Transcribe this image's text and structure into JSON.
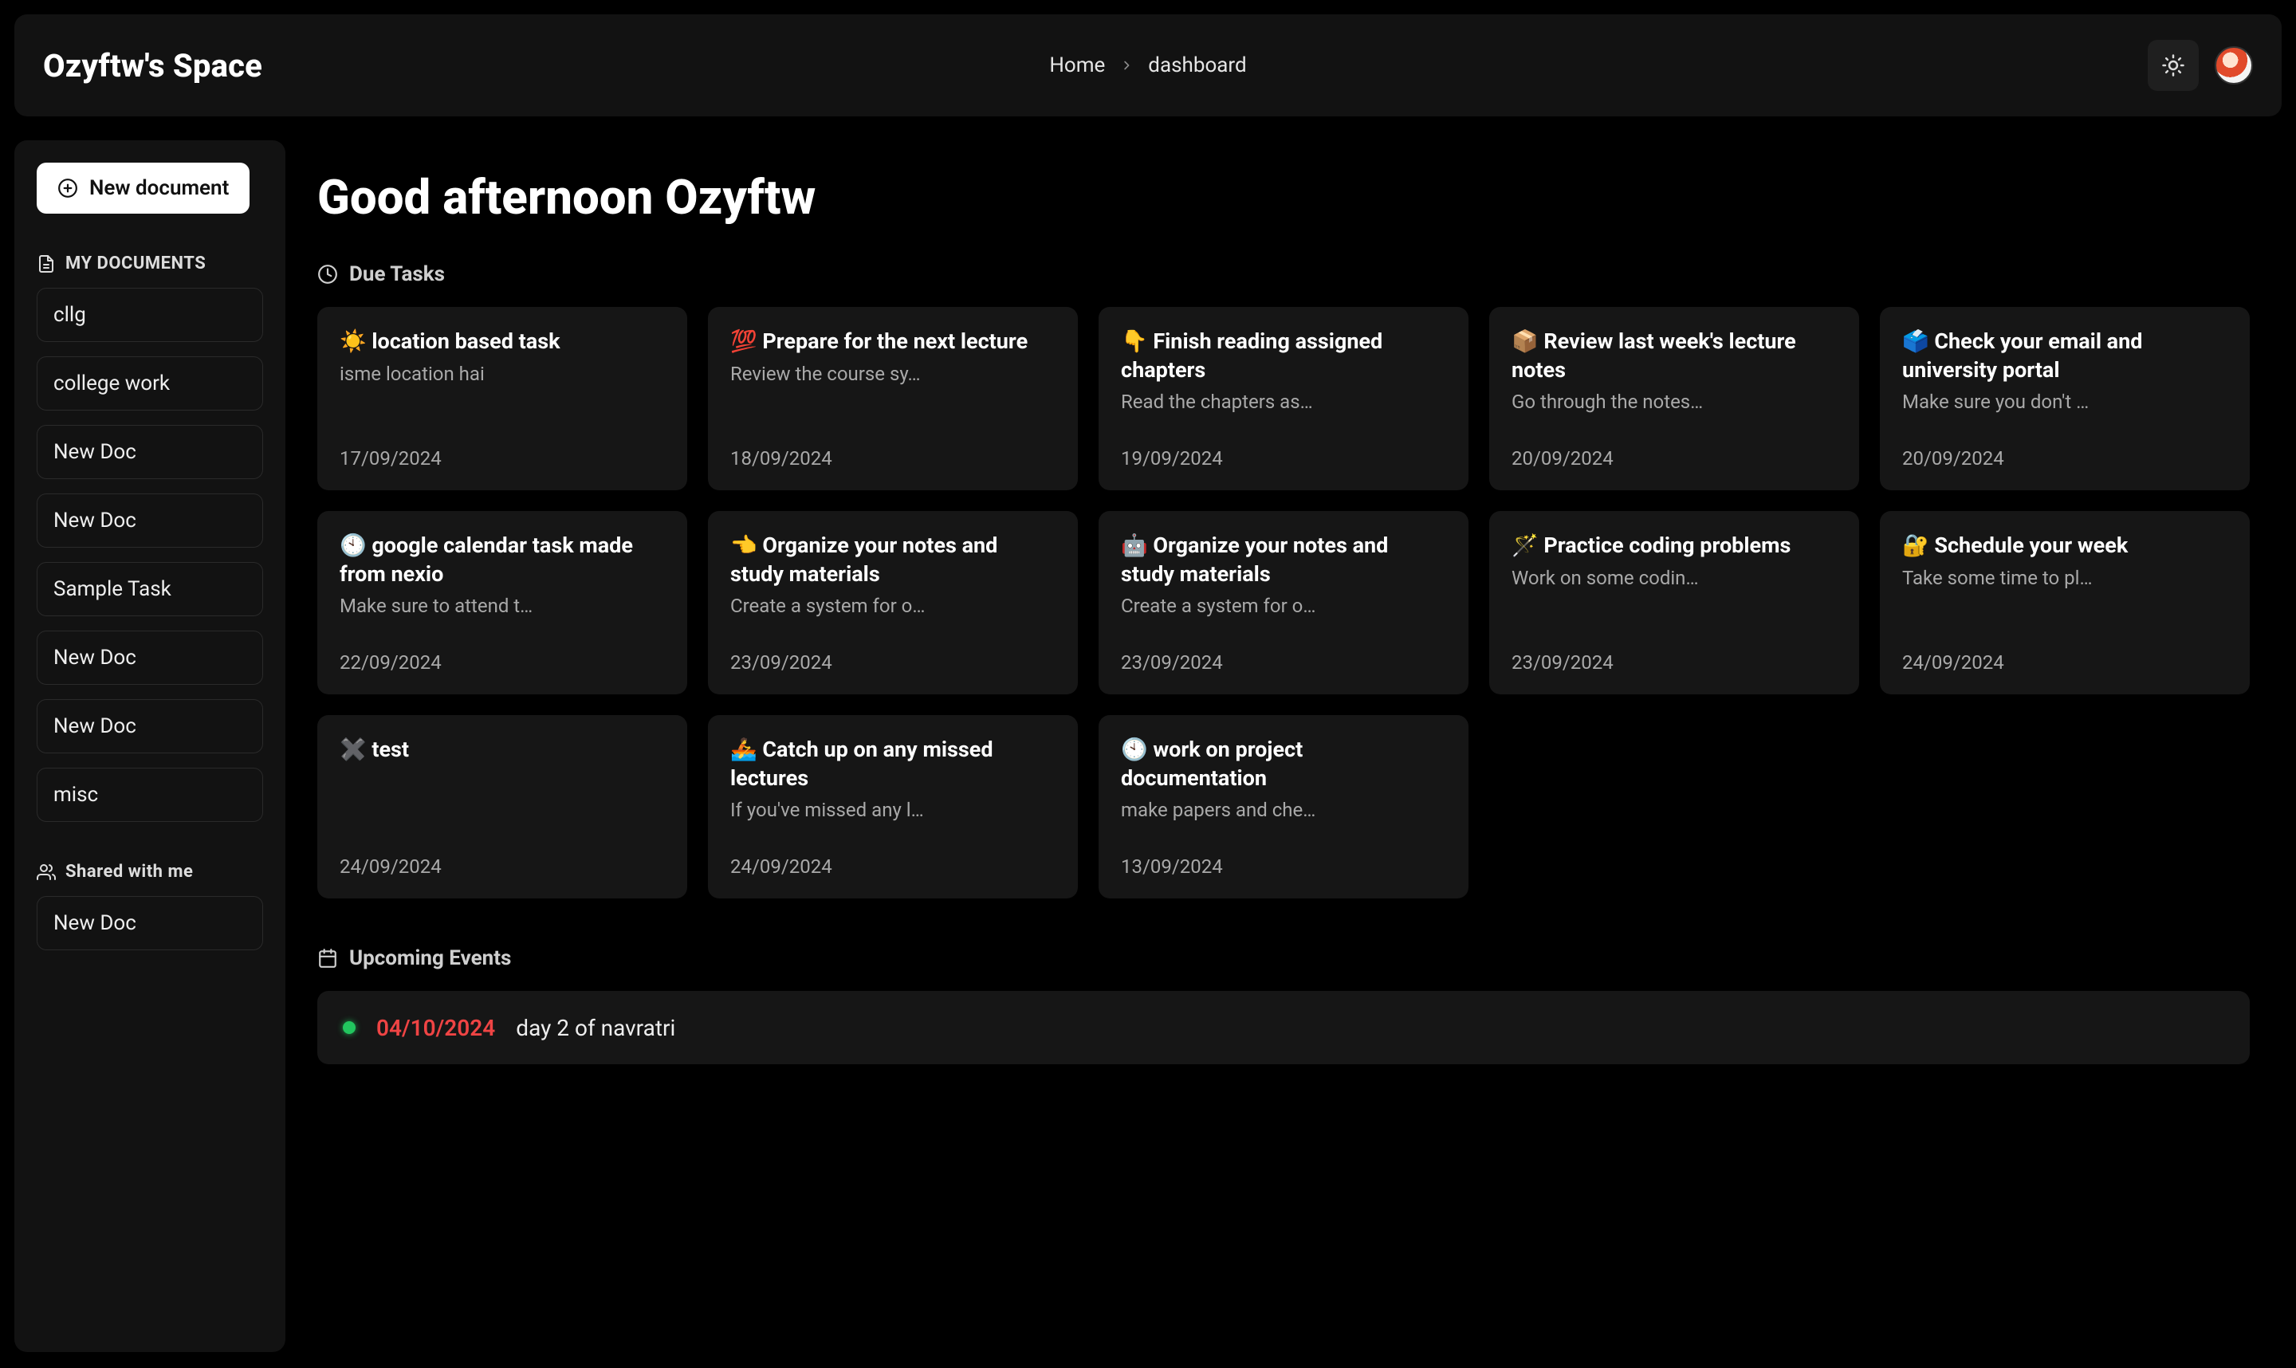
{
  "brand": "Ozyftw's Space",
  "breadcrumbs": {
    "home": "Home",
    "current": "dashboard"
  },
  "sidebar": {
    "new_document": "New document",
    "my_documents_label": "MY DOCUMENTS",
    "my_documents": [
      "cllg",
      "college work",
      "New Doc",
      "New Doc",
      "Sample Task",
      "New Doc",
      "New Doc",
      "misc"
    ],
    "shared_label": "Shared with me",
    "shared": [
      "New Doc"
    ]
  },
  "greeting": "Good afternoon Ozyftw",
  "due_tasks_label": "Due Tasks",
  "tasks": [
    {
      "emoji": "☀️",
      "title": "location based task",
      "desc": "isme location hai",
      "date": "17/09/2024"
    },
    {
      "emoji": "💯",
      "title": "Prepare for the next lecture",
      "desc": "Review the course sy…",
      "date": "18/09/2024"
    },
    {
      "emoji": "👇",
      "title": "Finish reading assigned chapters",
      "desc": "Read the chapters as…",
      "date": "19/09/2024"
    },
    {
      "emoji": "📦",
      "title": "Review last week's lecture notes",
      "desc": "Go through the notes…",
      "date": "20/09/2024"
    },
    {
      "emoji": "🗳️",
      "title": "Check your email and university portal",
      "desc": "Make sure you don't …",
      "date": "20/09/2024"
    },
    {
      "emoji": "🕙",
      "title": "google calendar task made from nexio",
      "desc": "Make sure to attend t…",
      "date": "22/09/2024"
    },
    {
      "emoji": "👈",
      "title": "Organize your notes and study materials",
      "desc": "Create a system for o…",
      "date": "23/09/2024"
    },
    {
      "emoji": "🤖",
      "title": "Organize your notes and study materials",
      "desc": "Create a system for o…",
      "date": "23/09/2024"
    },
    {
      "emoji": "🪄",
      "title": "Practice coding problems",
      "desc": "Work on some codin…",
      "date": "23/09/2024"
    },
    {
      "emoji": "🔐",
      "title": "Schedule your week",
      "desc": "Take some time to pl…",
      "date": "24/09/2024"
    },
    {
      "emoji": "✖️",
      "title": "test",
      "desc": "",
      "date": "24/09/2024"
    },
    {
      "emoji": "🚣",
      "title": "Catch up on any missed lectures",
      "desc": "If you've missed any l…",
      "date": "24/09/2024"
    },
    {
      "emoji": "🕙",
      "title": "work on project documentation",
      "desc": "make papers and che…",
      "date": "13/09/2024"
    }
  ],
  "upcoming_label": "Upcoming Events",
  "events": [
    {
      "date": "04/10/2024",
      "title": "day 2 of navratri"
    }
  ]
}
